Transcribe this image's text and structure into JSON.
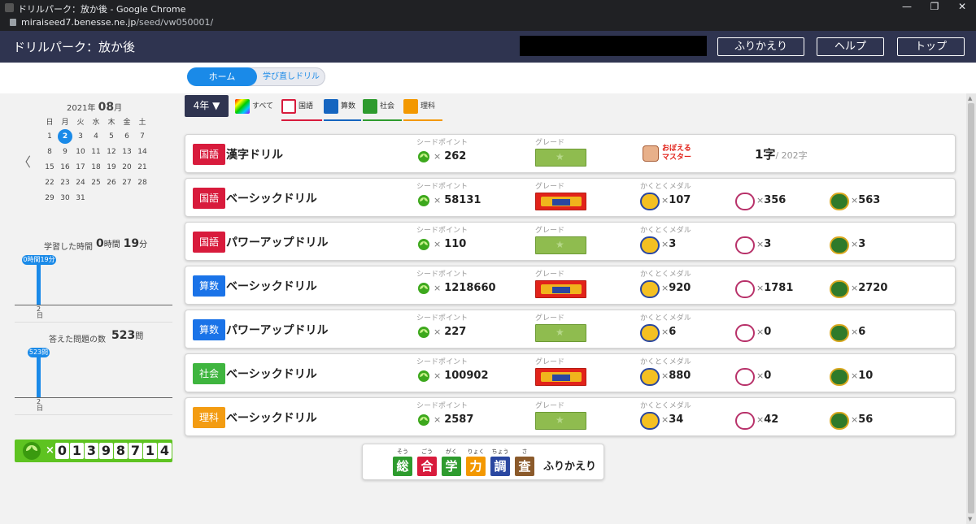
{
  "browser": {
    "title": "ドリルパーク：放か後 - Google Chrome",
    "url_host": "miraiseed7.benesse.ne.jp",
    "url_path": "/seed/vw050001/"
  },
  "header": {
    "title": "ドリルパーク：放か後",
    "buttons": [
      "ふりかえり",
      "ヘルプ",
      "トップ"
    ]
  },
  "tabs": {
    "home": "ホーム",
    "relearn": "学び直しドリル"
  },
  "calendar": {
    "year": "2021年",
    "month": "08",
    "month_suffix": "月",
    "weekdays": [
      "日",
      "月",
      "火",
      "水",
      "木",
      "金",
      "土"
    ],
    "days": [
      "1",
      "2",
      "3",
      "4",
      "5",
      "6",
      "7",
      "8",
      "9",
      "10",
      "11",
      "12",
      "13",
      "14",
      "15",
      "16",
      "17",
      "18",
      "19",
      "20",
      "21",
      "22",
      "23",
      "24",
      "25",
      "26",
      "27",
      "28",
      "29",
      "30",
      "31"
    ],
    "selected": "2",
    "prev_icon": "〈"
  },
  "study_time": {
    "label": "学習した時間",
    "hours": "0",
    "hours_unit": "時間",
    "minutes": "19",
    "minutes_unit": "分",
    "pill": "0時間19分",
    "day_label": "2日"
  },
  "answered": {
    "label": "答えた問題の数",
    "value": "523",
    "unit": "問",
    "pill": "523問",
    "day_label": "2日"
  },
  "seed_counter": {
    "x": "×",
    "digits": [
      "0",
      "1",
      "3",
      "9",
      "8",
      "7",
      "1",
      "4"
    ]
  },
  "filters": {
    "grade": "4年 ▼",
    "items": [
      {
        "label": "すべて",
        "icon": "rainbow-icon"
      },
      {
        "label": "国語",
        "icon": "kokugo-icon",
        "color": "#d81b3c"
      },
      {
        "label": "算数",
        "icon": "sansu-icon",
        "color": "#1565c0"
      },
      {
        "label": "社会",
        "icon": "globe-icon",
        "color": "#2e9b2e"
      },
      {
        "label": "理科",
        "icon": "rika-icon",
        "color": "#f39800"
      }
    ]
  },
  "labels": {
    "seed_point": "シードポイント",
    "grade": "グレード",
    "medals": "かくとくメダル",
    "times": "×"
  },
  "drills": [
    {
      "subject": "国語",
      "subject_color": "#d81b3c",
      "name": "漢字ドリル",
      "seed": "262",
      "grade": "green",
      "master": "おぼえるマスター",
      "kanji_count": "1字",
      "kanji_total": "/ 202字"
    },
    {
      "subject": "国語",
      "subject_color": "#d81b3c",
      "name": "ベーシックドリル",
      "seed": "58131",
      "grade": "red",
      "m1": "107",
      "m2": "356",
      "m3": "563"
    },
    {
      "subject": "国語",
      "subject_color": "#d81b3c",
      "name": "パワーアップドリル",
      "seed": "110",
      "grade": "green",
      "m1": "3",
      "m2": "3",
      "m3": "3"
    },
    {
      "subject": "算数",
      "subject_color": "#1a73e8",
      "name": "ベーシックドリル",
      "seed": "1218660",
      "grade": "red",
      "m1": "920",
      "m2": "1781",
      "m3": "2720"
    },
    {
      "subject": "算数",
      "subject_color": "#1a73e8",
      "name": "パワーアップドリル",
      "seed": "227",
      "grade": "green",
      "m1": "6",
      "m2": "0",
      "m3": "6"
    },
    {
      "subject": "社会",
      "subject_color": "#3fb53f",
      "name": "ベーシックドリル",
      "seed": "100902",
      "grade": "red",
      "m1": "880",
      "m2": "0",
      "m3": "10"
    },
    {
      "subject": "理科",
      "subject_color": "#f39c12",
      "name": "ベーシックドリル",
      "seed": "2587",
      "grade": "green",
      "m1": "34",
      "m2": "42",
      "m3": "56"
    }
  ],
  "sogo": {
    "kanji": [
      "総",
      "合",
      "学",
      "力",
      "調",
      "査"
    ],
    "ruby": [
      "そう",
      "ごう",
      "がく",
      "りょく",
      "ちょう",
      "さ"
    ],
    "colors": [
      "#2e9b2e",
      "#d81b3c",
      "#2e9b2e",
      "#f39800",
      "#2a47a0",
      "#8b5a2b"
    ],
    "label": "ふりかえり"
  }
}
